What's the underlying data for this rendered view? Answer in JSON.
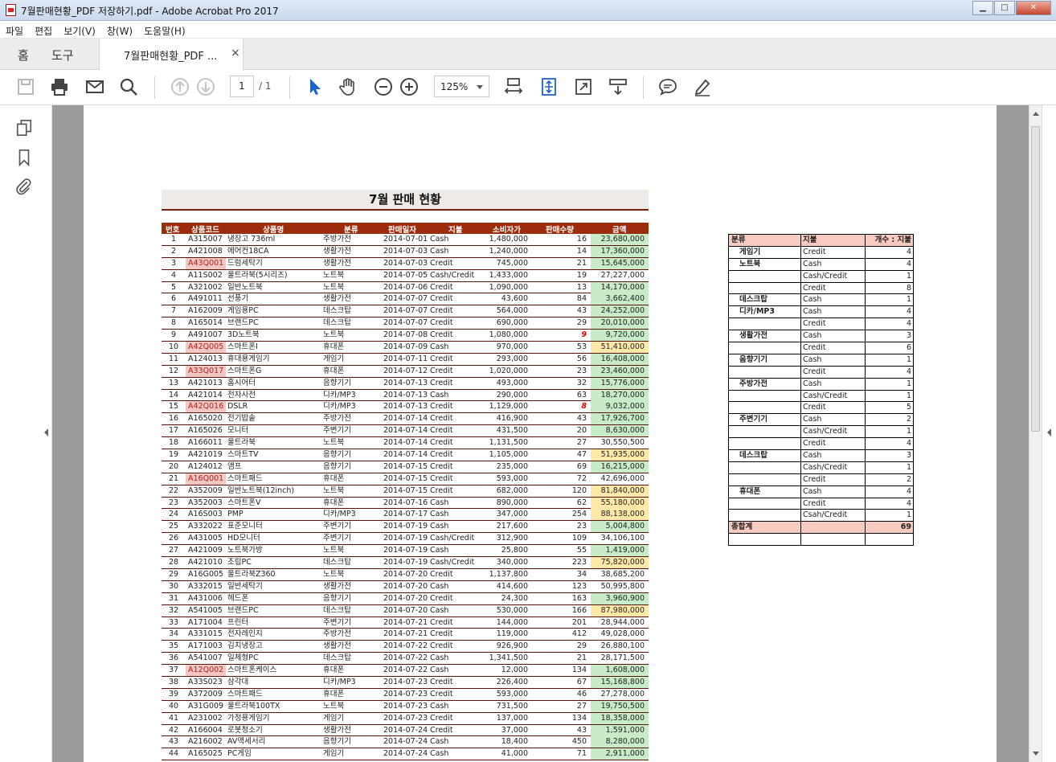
{
  "window": {
    "title": "7월판매현황_PDF 저장하기.pdf - Adobe Acrobat Pro 2017"
  },
  "menu": [
    "파일",
    "편집",
    "보기(V)",
    "창(W)",
    "도움말(H)"
  ],
  "tabs": {
    "home": "홈",
    "tools": "도구",
    "doc": "7월판매현황_PDF ...",
    "close": "×"
  },
  "toolbar": {
    "page_current": "1",
    "page_total": "/ 1",
    "zoom": "125%"
  },
  "report": {
    "title": "7월 판매 현황",
    "headers": [
      "번호",
      "상품코드",
      "상품명",
      "분류",
      "판매일자",
      "지불",
      "소비자가",
      "판매수량",
      "금액"
    ],
    "rows": [
      [
        "1",
        "A315007",
        "냉장고 736ml",
        "주방가전",
        "2014-07-01",
        "Cash",
        "1,480,000",
        "16",
        "23,680,000"
      ],
      [
        "2",
        "A421008",
        "에어컨18CA",
        "생활가전",
        "2014-07-03",
        "Cash",
        "1,240,000",
        "14",
        "17,360,000"
      ],
      [
        "3",
        "A43Q001",
        "드럼세탁기",
        "생활가전",
        "2014-07-03",
        "Credit",
        "745,000",
        "21",
        "15,645,000"
      ],
      [
        "4",
        "A11S002",
        "울트라북(5시리즈)",
        "노트북",
        "2014-07-05",
        "Cash/Credit",
        "1,433,000",
        "19",
        "27,227,000"
      ],
      [
        "5",
        "A321002",
        "일반노트북",
        "노트북",
        "2014-07-06",
        "Credit",
        "1,090,000",
        "13",
        "14,170,000"
      ],
      [
        "6",
        "A491011",
        "선풍기",
        "생활가전",
        "2014-07-07",
        "Credit",
        "43,600",
        "84",
        "3,662,400"
      ],
      [
        "7",
        "A162009",
        "게임용PC",
        "데스크탑",
        "2014-07-07",
        "Credit",
        "564,000",
        "43",
        "24,252,000"
      ],
      [
        "8",
        "A165014",
        "브랜드PC",
        "데스크탑",
        "2014-07-07",
        "Credit",
        "690,000",
        "29",
        "20,010,000"
      ],
      [
        "9",
        "A491007",
        "3D노트북",
        "노트북",
        "2014-07-08",
        "Credit",
        "1,080,000",
        "9",
        "9,720,000"
      ],
      [
        "10",
        "A42Q005",
        "스마트폰I",
        "휴대폰",
        "2014-07-09",
        "Cash",
        "970,000",
        "53",
        "51,410,000"
      ],
      [
        "11",
        "A124013",
        "휴대용게임기",
        "게임기",
        "2014-07-11",
        "Credit",
        "293,000",
        "56",
        "16,408,000"
      ],
      [
        "12",
        "A33Q017",
        "스마트폰G",
        "휴대폰",
        "2014-07-12",
        "Credit",
        "1,020,000",
        "23",
        "23,460,000"
      ],
      [
        "13",
        "A421013",
        "홈시어터",
        "음향기기",
        "2014-07-13",
        "Credit",
        "493,000",
        "32",
        "15,776,000"
      ],
      [
        "14",
        "A421014",
        "전자사전",
        "디카/MP3",
        "2014-07-13",
        "Cash",
        "290,000",
        "63",
        "18,270,000"
      ],
      [
        "15",
        "A42Q016",
        "DSLR",
        "디카/MP3",
        "2014-07-13",
        "Credit",
        "1,129,000",
        "8",
        "9,032,000"
      ],
      [
        "16",
        "A165020",
        "전기밥솥",
        "주방가전",
        "2014-07-14",
        "Credit",
        "416,900",
        "43",
        "17,926,700"
      ],
      [
        "17",
        "A165026",
        "모니터",
        "주변기기",
        "2014-07-14",
        "Credit",
        "431,500",
        "20",
        "8,630,000"
      ],
      [
        "18",
        "A166011",
        "울트라북",
        "노트북",
        "2014-07-14",
        "Credit",
        "1,131,500",
        "27",
        "30,550,500"
      ],
      [
        "19",
        "A421019",
        "스마트TV",
        "음향기기",
        "2014-07-14",
        "Credit",
        "1,105,000",
        "47",
        "51,935,000"
      ],
      [
        "20",
        "A124012",
        "앰프",
        "음향기기",
        "2014-07-15",
        "Credit",
        "235,000",
        "69",
        "16,215,000"
      ],
      [
        "21",
        "A16Q001",
        "스마트패드",
        "휴대폰",
        "2014-07-15",
        "Credit",
        "593,000",
        "72",
        "42,696,000"
      ],
      [
        "22",
        "A352009",
        "일반노트북(12inch)",
        "노트북",
        "2014-07-15",
        "Credit",
        "682,000",
        "120",
        "81,840,000"
      ],
      [
        "23",
        "A352003",
        "스마트폰V",
        "휴대폰",
        "2014-07-16",
        "Cash",
        "890,000",
        "62",
        "55,180,000"
      ],
      [
        "24",
        "A16S003",
        "PMP",
        "디카/MP3",
        "2014-07-17",
        "Cash",
        "347,000",
        "254",
        "88,138,000"
      ],
      [
        "25",
        "A332022",
        "표준모니터",
        "주변기기",
        "2014-07-19",
        "Cash",
        "217,600",
        "23",
        "5,004,800"
      ],
      [
        "26",
        "A431005",
        "HD모니터",
        "주변기기",
        "2014-07-19",
        "Cash/Credit",
        "312,900",
        "109",
        "34,106,100"
      ],
      [
        "27",
        "A421009",
        "노트북가방",
        "노트북",
        "2014-07-19",
        "Cash",
        "25,800",
        "55",
        "1,419,000"
      ],
      [
        "28",
        "A421010",
        "조립PC",
        "데스크탑",
        "2014-07-19",
        "Cash/Credit",
        "340,000",
        "223",
        "75,820,000"
      ],
      [
        "29",
        "A16G005",
        "울트라북Z360",
        "노트북",
        "2014-07-20",
        "Credit",
        "1,137,800",
        "34",
        "38,685,200"
      ],
      [
        "30",
        "A332015",
        "일반세탁기",
        "생활가전",
        "2014-07-20",
        "Cash",
        "414,600",
        "123",
        "50,995,800"
      ],
      [
        "31",
        "A431006",
        "헤드폰",
        "음향기기",
        "2014-07-20",
        "Credit",
        "24,300",
        "163",
        "3,960,900"
      ],
      [
        "32",
        "A541005",
        "브랜드PC",
        "데스크탑",
        "2014-07-20",
        "Cash",
        "530,000",
        "166",
        "87,980,000"
      ],
      [
        "33",
        "A171004",
        "프린터",
        "주변기기",
        "2014-07-21",
        "Credit",
        "144,000",
        "201",
        "28,944,000"
      ],
      [
        "34",
        "A331015",
        "전자레인지",
        "주방가전",
        "2014-07-21",
        "Credit",
        "119,000",
        "412",
        "49,028,000"
      ],
      [
        "35",
        "A171003",
        "김치냉장고",
        "생활가전",
        "2014-07-22",
        "Credit",
        "926,900",
        "29",
        "26,880,100"
      ],
      [
        "36",
        "A541007",
        "일체형PC",
        "데스크탑",
        "2014-07-22",
        "Cash",
        "1,341,500",
        "21",
        "28,171,500"
      ],
      [
        "37",
        "A12Q002",
        "스마트폰케이스",
        "휴대폰",
        "2014-07-22",
        "Cash",
        "12,000",
        "134",
        "1,608,000"
      ],
      [
        "38",
        "A33S023",
        "삼각대",
        "디카/MP3",
        "2014-07-23",
        "Credit",
        "226,400",
        "67",
        "15,168,800"
      ],
      [
        "39",
        "A372009",
        "스마트패드",
        "휴대폰",
        "2014-07-23",
        "Credit",
        "593,000",
        "46",
        "27,278,000"
      ],
      [
        "40",
        "A31G009",
        "울트라북100TX",
        "노트북",
        "2014-07-23",
        "Cash",
        "731,500",
        "27",
        "19,750,500"
      ],
      [
        "41",
        "A231002",
        "가정용게임기",
        "게임기",
        "2014-07-23",
        "Credit",
        "137,000",
        "134",
        "18,358,000"
      ],
      [
        "42",
        "A166004",
        "로봇청소기",
        "생활가전",
        "2014-07-24",
        "Credit",
        "37,000",
        "43",
        "1,591,000"
      ],
      [
        "43",
        "A216002",
        "AV액세서리",
        "음향기기",
        "2014-07-24",
        "Cash",
        "18,400",
        "450",
        "8,280,000"
      ],
      [
        "44",
        "A165025",
        "PC게임",
        "게임기",
        "2014-07-24",
        "Cash",
        "41,000",
        "71",
        "2,911,000"
      ]
    ],
    "highlight_codes": [
      3,
      10,
      12,
      15,
      21,
      37
    ],
    "red_qty": [
      9,
      15
    ],
    "amount_fill": [
      "g",
      "g",
      "g",
      "",
      "g",
      "g",
      "g",
      "g",
      "g",
      "y",
      "g",
      "g",
      "g",
      "g",
      "g",
      "g",
      "g",
      "",
      "y",
      "g",
      "",
      "y",
      "y",
      "y",
      "g",
      "",
      "g",
      "y",
      "",
      "",
      "g",
      "y",
      "",
      "",
      "",
      "",
      "g",
      "g",
      "",
      "g",
      "g",
      "g",
      "g",
      "g"
    ]
  },
  "pivot": {
    "headers": [
      "분류",
      "지불",
      "개수 : 지불"
    ],
    "rows": [
      [
        "게임기",
        "Credit",
        "4"
      ],
      [
        "노트북",
        "Cash",
        "4"
      ],
      [
        "",
        "Cash/Credit",
        "1"
      ],
      [
        "",
        "Credit",
        "8"
      ],
      [
        "데스크탑",
        "Cash",
        "1"
      ],
      [
        "디카/MP3",
        "Cash",
        "4"
      ],
      [
        "",
        "Credit",
        "4"
      ],
      [
        "생활가전",
        "Cash",
        "3"
      ],
      [
        "",
        "Credit",
        "6"
      ],
      [
        "음향기기",
        "Cash",
        "1"
      ],
      [
        "",
        "Credit",
        "4"
      ],
      [
        "주방가전",
        "Cash",
        "1"
      ],
      [
        "",
        "Cash/Credit",
        "1"
      ],
      [
        "",
        "Credit",
        "5"
      ],
      [
        "주변기기",
        "Cash",
        "2"
      ],
      [
        "",
        "Cash/Credit",
        "1"
      ],
      [
        "",
        "Credit",
        "4"
      ],
      [
        "데스크탑",
        "Cash",
        "3"
      ],
      [
        "",
        "Cash/Credit",
        "1"
      ],
      [
        "",
        "Credit",
        "2"
      ],
      [
        "휴대폰",
        "Cash",
        "4"
      ],
      [
        "",
        "Credit",
        "4"
      ],
      [
        "",
        "Csah/Credit",
        "1"
      ]
    ],
    "total": [
      "총합계",
      "",
      "69"
    ]
  }
}
